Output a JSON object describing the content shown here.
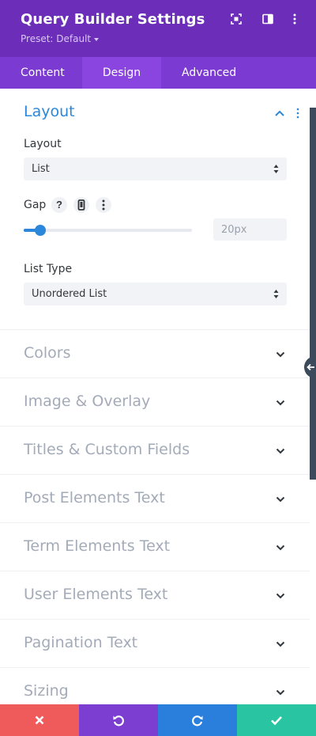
{
  "header": {
    "title": "Query Builder Settings",
    "preset": "Preset: Default",
    "icons": [
      "expand-icon",
      "sidebar-toggle-icon",
      "more-vertical-icon"
    ]
  },
  "tabs": [
    {
      "label": "Content",
      "active": false
    },
    {
      "label": "Design",
      "active": true
    },
    {
      "label": "Advanced",
      "active": false
    }
  ],
  "layout_section": {
    "title": "Layout",
    "layout_label": "Layout",
    "layout_value": "List",
    "gap_label": "Gap",
    "gap_value": "20px",
    "gap_slider_fraction": 0.1,
    "list_type_label": "List Type",
    "list_type_value": "Unordered List"
  },
  "collapsed_sections": [
    "Colors",
    "Image & Overlay",
    "Titles & Custom Fields",
    "Post Elements Text",
    "Term Elements Text",
    "User Elements Text",
    "Pagination Text",
    "Sizing"
  ],
  "footer": {
    "buttons": [
      {
        "name": "cancel",
        "icon": "close-icon",
        "color": "#ef5b5b"
      },
      {
        "name": "undo",
        "icon": "undo-icon",
        "color": "#7c3ed0"
      },
      {
        "name": "redo",
        "icon": "redo-icon",
        "color": "#2b7fdc"
      },
      {
        "name": "save",
        "icon": "check-icon",
        "color": "#29c4a2"
      }
    ]
  },
  "colors": {
    "header_bg": "#6c2eb9",
    "tabs_bg": "#7b3ad1",
    "accent_blue": "#2b87da"
  }
}
